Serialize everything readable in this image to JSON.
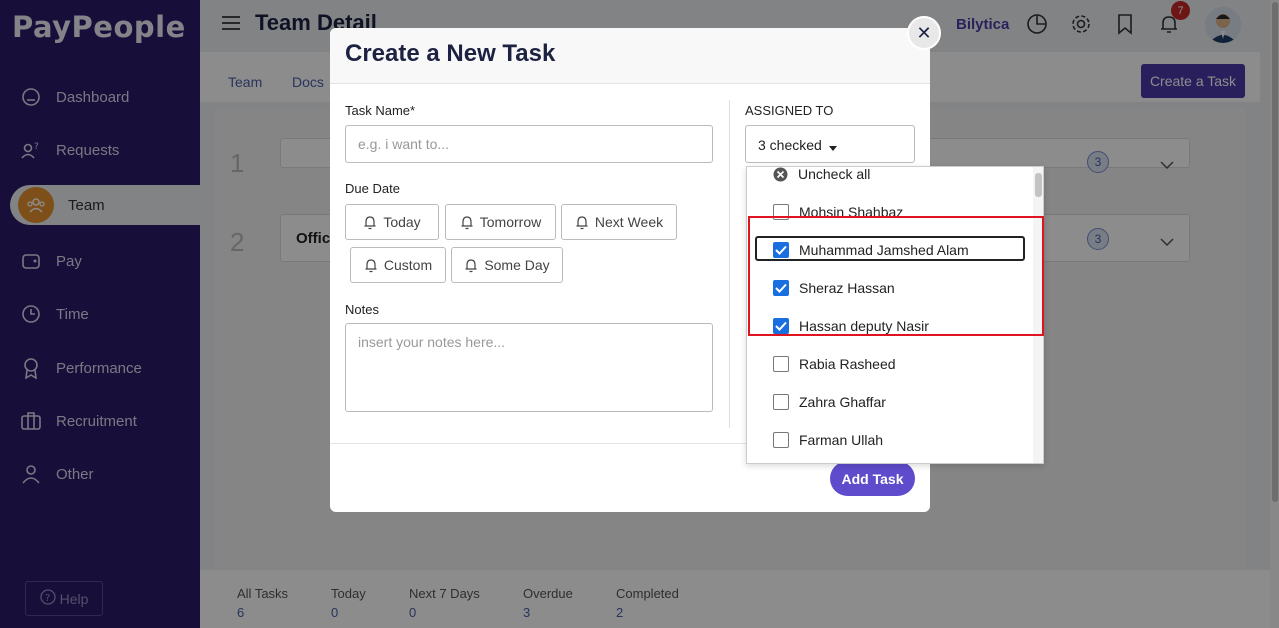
{
  "app": {
    "logo": "PayPeople"
  },
  "sidebar": {
    "items": [
      {
        "label": "Dashboard",
        "icon": "dashboard-icon"
      },
      {
        "label": "Requests",
        "icon": "requests-icon"
      },
      {
        "label": "Team",
        "icon": "team-icon",
        "active": true
      },
      {
        "label": "Pay",
        "icon": "pay-icon"
      },
      {
        "label": "Time",
        "icon": "clock-icon"
      },
      {
        "label": "Performance",
        "icon": "award-icon"
      },
      {
        "label": "Recruitment",
        "icon": "briefcase-icon"
      },
      {
        "label": "Other",
        "icon": "user-icon"
      }
    ],
    "help": "Help"
  },
  "header": {
    "title": "Team Detail",
    "org": "Bilytica",
    "notifications": "7"
  },
  "subnav": {
    "links": [
      "Team",
      "Docs"
    ],
    "create_task": "Create a Task"
  },
  "rows": [
    {
      "num": "1",
      "text": "",
      "count": "3"
    },
    {
      "num": "2",
      "text": "Offic",
      "count": "3"
    }
  ],
  "stats": [
    {
      "label": "All Tasks",
      "value": "6"
    },
    {
      "label": "Today",
      "value": "0"
    },
    {
      "label": "Next 7 Days",
      "value": "0"
    },
    {
      "label": "Overdue",
      "value": "3"
    },
    {
      "label": "Completed",
      "value": "2"
    }
  ],
  "modal": {
    "title": "Create a New Task",
    "task_name_label": "Task Name*",
    "task_name_placeholder": "e.g. i want to...",
    "due_date_label": "Due Date",
    "due_buttons": [
      "Today",
      "Tomorrow",
      "Next Week",
      "Custom",
      "Some Day"
    ],
    "notes_label": "Notes",
    "notes_placeholder": "insert your notes here...",
    "assigned_label": "ASSIGNED TO",
    "assigned_value": "3 checked",
    "add_task": "Add Task"
  },
  "dropdown": {
    "uncheck_all": "Uncheck all",
    "options": [
      {
        "label": "Mohsin Shahbaz",
        "checked": false
      },
      {
        "label": "Muhammad Jamshed Alam",
        "checked": true
      },
      {
        "label": "Sheraz Hassan",
        "checked": true
      },
      {
        "label": "Hassan deputy Nasir",
        "checked": true
      },
      {
        "label": "Rabia Rasheed",
        "checked": false
      },
      {
        "label": "Zahra Ghaffar",
        "checked": false
      },
      {
        "label": "Farman Ullah",
        "checked": false
      }
    ]
  },
  "colors": {
    "sidebar": "#2c1a6b",
    "accent": "#5e4ccc",
    "checkbox": "#1a6fe0",
    "highlight": "#e0141e"
  }
}
